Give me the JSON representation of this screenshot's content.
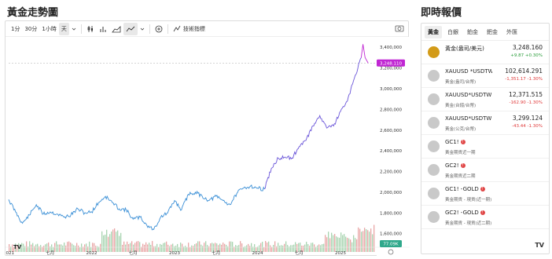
{
  "chart": {
    "title": "黃金走勢圖",
    "toolbar": {
      "interval_1m": "1分",
      "interval_30m": "30分",
      "interval_1h": "1小時",
      "interval_day": "天",
      "indicators_label": "技術指標"
    },
    "price_tag": "3,248.110",
    "volume_tag": "77.09K",
    "tv_logo": "TV"
  },
  "chart_data": {
    "type": "line",
    "title": "",
    "xlabel": "",
    "ylabel": "",
    "y_axis_ticks": [
      "3,400,000",
      "3,200,000",
      "3,000,000",
      "2,800,000",
      "2,600,000",
      "2,400,000",
      "2,200,000",
      "2,000,000",
      "1,800,000",
      "1,600,000"
    ],
    "y_tick_values": [
      3400000,
      3200000,
      3000000,
      2800000,
      2600000,
      2400000,
      2200000,
      2000000,
      1800000,
      1600000
    ],
    "x_axis_ticks": [
      "2021",
      "七月",
      "2022",
      "七月",
      "2023",
      "七月",
      "2024",
      "七月",
      "2025",
      "七月"
    ],
    "ylim": [
      1560000,
      3470000
    ],
    "current_value": 3248110,
    "series": [
      {
        "color": "#3a8fd6",
        "x": [
          "2021-01",
          "2021-02",
          "2021-03",
          "2021-04",
          "2021-05",
          "2021-06",
          "2021-07",
          "2021-08",
          "2021-09",
          "2021-10",
          "2021-11",
          "2021-12",
          "2022-01",
          "2022-02",
          "2022-03",
          "2022-04",
          "2022-05",
          "2022-06",
          "2022-07",
          "2022-08",
          "2022-09",
          "2022-10",
          "2022-11",
          "2022-12",
          "2023-01",
          "2023-02",
          "2023-03",
          "2023-04",
          "2023-05",
          "2023-06",
          "2023-07",
          "2023-08",
          "2023-09",
          "2023-10",
          "2023-11",
          "2023-12",
          "2024-01",
          "2024-02"
        ],
        "values": [
          1930000,
          1810000,
          1700000,
          1780000,
          1880000,
          1790000,
          1810000,
          1790000,
          1760000,
          1780000,
          1840000,
          1800000,
          1810000,
          1900000,
          1960000,
          1900000,
          1840000,
          1830000,
          1740000,
          1760000,
          1680000,
          1640000,
          1760000,
          1800000,
          1920000,
          1830000,
          1980000,
          2000000,
          1960000,
          1920000,
          1960000,
          1920000,
          1880000,
          1990000,
          2040000,
          2060000,
          2040000,
          2030000
        ]
      },
      {
        "color": "#6a55d9",
        "x": [
          "2024-02",
          "2024-03",
          "2024-04",
          "2024-05",
          "2024-06",
          "2024-07",
          "2024-08",
          "2024-09",
          "2024-10",
          "2024-11",
          "2024-12",
          "2025-01",
          "2025-02",
          "2025-03",
          "2025-04"
        ],
        "values": [
          2030000,
          2230000,
          2330000,
          2340000,
          2330000,
          2440000,
          2500000,
          2640000,
          2740000,
          2620000,
          2640000,
          2780000,
          2880000,
          3100000,
          3300000
        ]
      },
      {
        "color": "#c026d3",
        "x": [
          "2025-04",
          "2025-04b",
          "2025-04c",
          "2025-05"
        ],
        "values": [
          3300000,
          3430000,
          3300000,
          3248110
        ]
      }
    ],
    "volume_note": "volume bars shown along bottom",
    "grid": false
  },
  "quotes": {
    "title": "即時報價",
    "tabs": [
      "黃金",
      "白銀",
      "鉑金",
      "鈀金",
      "外匯"
    ],
    "active_tab": "黃金",
    "items": [
      {
        "name": "黃金(盎司/美元)",
        "sub": "",
        "price": "3,248.160",
        "change": "+9.87",
        "pct": "+0.30%",
        "dir": "up",
        "icon": "gold"
      },
      {
        "name": "XAUUSD *USDTW",
        "sub": "黃金(盎司/台幣)",
        "price": "102,614.291",
        "change": "-1,351.17",
        "pct": "-1.30%",
        "dir": "dn",
        "icon": "gray"
      },
      {
        "name": "XAUUSD*USDTWD",
        "sub": "黃金(台錢/台幣)",
        "price": "12,371.515",
        "change": "-162.90",
        "pct": "-1.30%",
        "dir": "dn",
        "icon": "gray"
      },
      {
        "name": "XAUUSD*USDTWD/",
        "sub": "黃金(公克/台幣)",
        "price": "3,299.124",
        "change": "-43.44",
        "pct": "-1.30%",
        "dir": "dn",
        "icon": "gray"
      },
      {
        "name": "GC1!",
        "sub": "黃金期貨近一期",
        "price": "",
        "change": "",
        "pct": "",
        "dir": "",
        "icon": "gray",
        "badge": "!"
      },
      {
        "name": "GC2!",
        "sub": "黃金期貨近二期",
        "price": "",
        "change": "",
        "pct": "",
        "dir": "",
        "icon": "gray",
        "badge": "!"
      },
      {
        "name": "GC1! -GOLD",
        "sub": "黃金期貨 - 現貨(近一期)",
        "price": "",
        "change": "",
        "pct": "",
        "dir": "",
        "icon": "gray",
        "badge": "!"
      },
      {
        "name": "GC2! -GOLD",
        "sub": "黃金期貨 - 現貨(近二期)",
        "price": "",
        "change": "",
        "pct": "",
        "dir": "",
        "icon": "gray",
        "badge": "!"
      }
    ],
    "footer_logo": "TV"
  }
}
